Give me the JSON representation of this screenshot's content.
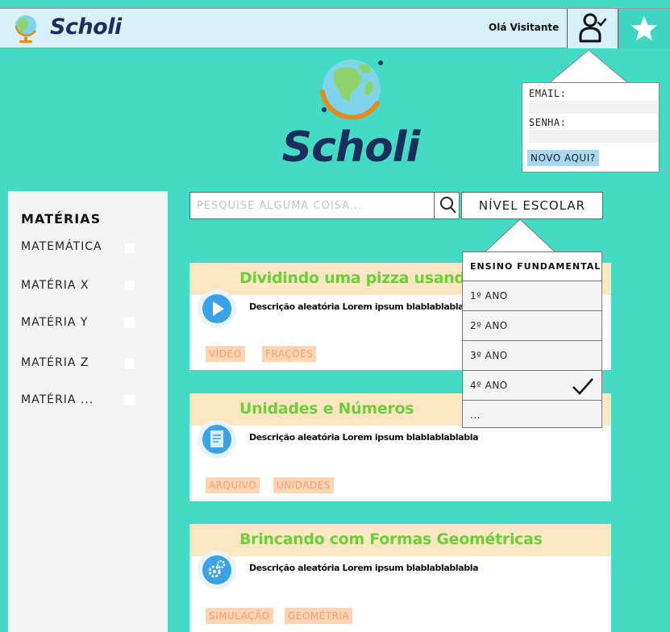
{
  "header": {
    "brand": "Scholi",
    "greeting": "Olá Visitante"
  },
  "hero": {
    "brand": "Scholi"
  },
  "login": {
    "email_label": "EMAIL:",
    "password_label": "SENHA:",
    "signup_link": "NOVO AQUI?"
  },
  "sidebar": {
    "title": "MATÉRIAS",
    "items": [
      {
        "label": "MATEMÁTICA"
      },
      {
        "label": "MATÉRIA X"
      },
      {
        "label": "MATÉRIA Y"
      },
      {
        "label": "MATÉRIA Z"
      },
      {
        "label": "MATÉRIA ..."
      }
    ]
  },
  "search": {
    "placeholder": "PESQUISE ALGUMA COISA...",
    "level_label": "NÍVEL ESCOLAR"
  },
  "dropdown": {
    "header": "ENSINO FUNDAMENTAL",
    "items": [
      {
        "label": "1º ANO"
      },
      {
        "label": "2º ANO"
      },
      {
        "label": "3º ANO"
      },
      {
        "label": "4º ANO",
        "selected": true
      },
      {
        "label": "..."
      }
    ]
  },
  "cards": [
    {
      "title": "Dividindo uma pizza usando frações",
      "icon": "play-icon",
      "description": "Descrição aleatória Lorem ipsum blablablablabla",
      "tags": [
        "VÍDEO",
        "FRAÇÕES"
      ]
    },
    {
      "title": "Unidades e Números",
      "icon": "document-icon",
      "description": "Descrição aleatória Lorem ipsum blablablablabla",
      "tags": [
        "ARQUIVO",
        "UNIDADES"
      ]
    },
    {
      "title": "Brincando com Formas Geométricas",
      "icon": "gears-icon",
      "description": "Descrição aleatória Lorem ipsum blablablablabla",
      "tags": [
        "SIMULAÇÃO",
        "GEOMETRIA"
      ]
    }
  ],
  "colors": {
    "background": "#44dbc5",
    "topbar": "#d6f1f8",
    "card_header": "#fde7c3",
    "card_title": "#6ccf3a",
    "tag_bg": "#fdd4b4",
    "tag_text": "#f7a272",
    "icon_blue": "#3aa3e8",
    "brand_navy": "#1a2d5c"
  }
}
